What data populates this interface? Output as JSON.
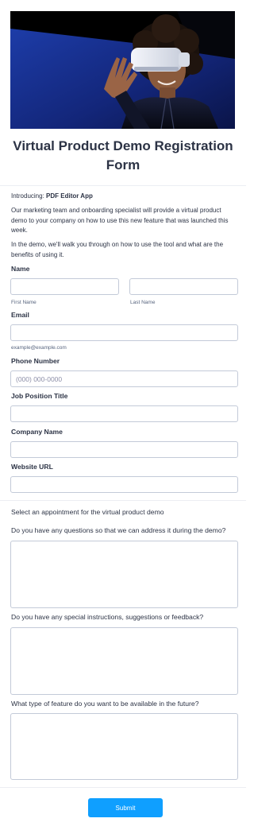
{
  "form": {
    "title": "Virtual Product Demo Registration Form",
    "intro": {
      "introducing_prefix": "Introducing: ",
      "product_name": "PDF Editor App",
      "paragraph_1": "Our marketing team and onboarding specialist will provide a virtual product demo to your company on how to use this new feature that was launched this week.",
      "paragraph_2": "In the demo, we'll walk you through on how to use the tool and what are the benefits of using it."
    },
    "name": {
      "label": "Name",
      "first_sublabel": "First Name",
      "last_sublabel": "Last Name",
      "first_value": "",
      "last_value": ""
    },
    "email": {
      "label": "Email",
      "sublabel": "example@example.com",
      "value": ""
    },
    "phone": {
      "label": "Phone Number",
      "placeholder": "(000) 000-0000",
      "value": ""
    },
    "job": {
      "label": "Job Position Title",
      "value": ""
    },
    "company": {
      "label": "Company Name",
      "value": ""
    },
    "website": {
      "label": "Website URL",
      "value": ""
    },
    "appointment": {
      "label": "Select an appointment for the virtual product demo"
    },
    "questions": {
      "label": "Do you have any questions so that we can address it during the demo?",
      "value": ""
    },
    "instructions": {
      "label": "Do you have any special instructions, suggestions or feedback?",
      "value": ""
    },
    "future_feature": {
      "label": "What type of feature do you want to be available in the future?",
      "value": ""
    },
    "submit_label": "Submit"
  },
  "colors": {
    "submit_button": "#0f9fff",
    "text": "#2c3345",
    "field_border": "#c3cad8"
  }
}
